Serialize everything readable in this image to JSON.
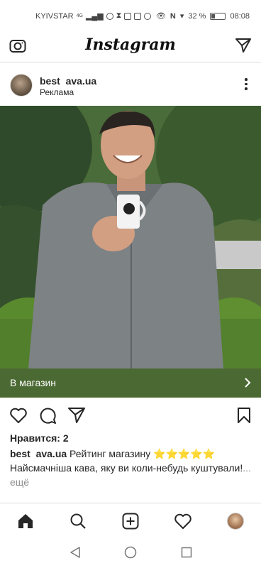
{
  "status_bar": {
    "carrier": "KYIVSTAR",
    "network": "4G",
    "battery": "32 %",
    "battery_level": 0.32,
    "time": "08:08"
  },
  "header": {
    "logo": "Instagram",
    "left_icon": "camera-icon",
    "right_icon": "direct-message-icon"
  },
  "post": {
    "username": "best  ava.ua",
    "sponsored_label": "Реклама",
    "menu_icon": "more-options-icon",
    "shop_button": "В магазин",
    "likes": "Нравится: 2",
    "caption_user": "best  ava.ua",
    "caption_text": " Рейтинг магазину ⭐⭐⭐⭐⭐",
    "caption_line2": "Найсмачніша кава, яку ви коли-небудь куштували!",
    "more_label": "... ещё"
  },
  "actions": [
    "heart-icon",
    "comment-icon",
    "share-icon",
    "bookmark-icon"
  ],
  "tabs": [
    "home-icon",
    "search-icon",
    "new-post-icon",
    "activity-icon",
    "profile-avatar"
  ],
  "nav": [
    "back-icon",
    "home-circle-icon",
    "recents-icon"
  ],
  "colors": {
    "shop_bar": "#4b6a33",
    "text": "#262626",
    "muted": "#8e8e8e"
  }
}
